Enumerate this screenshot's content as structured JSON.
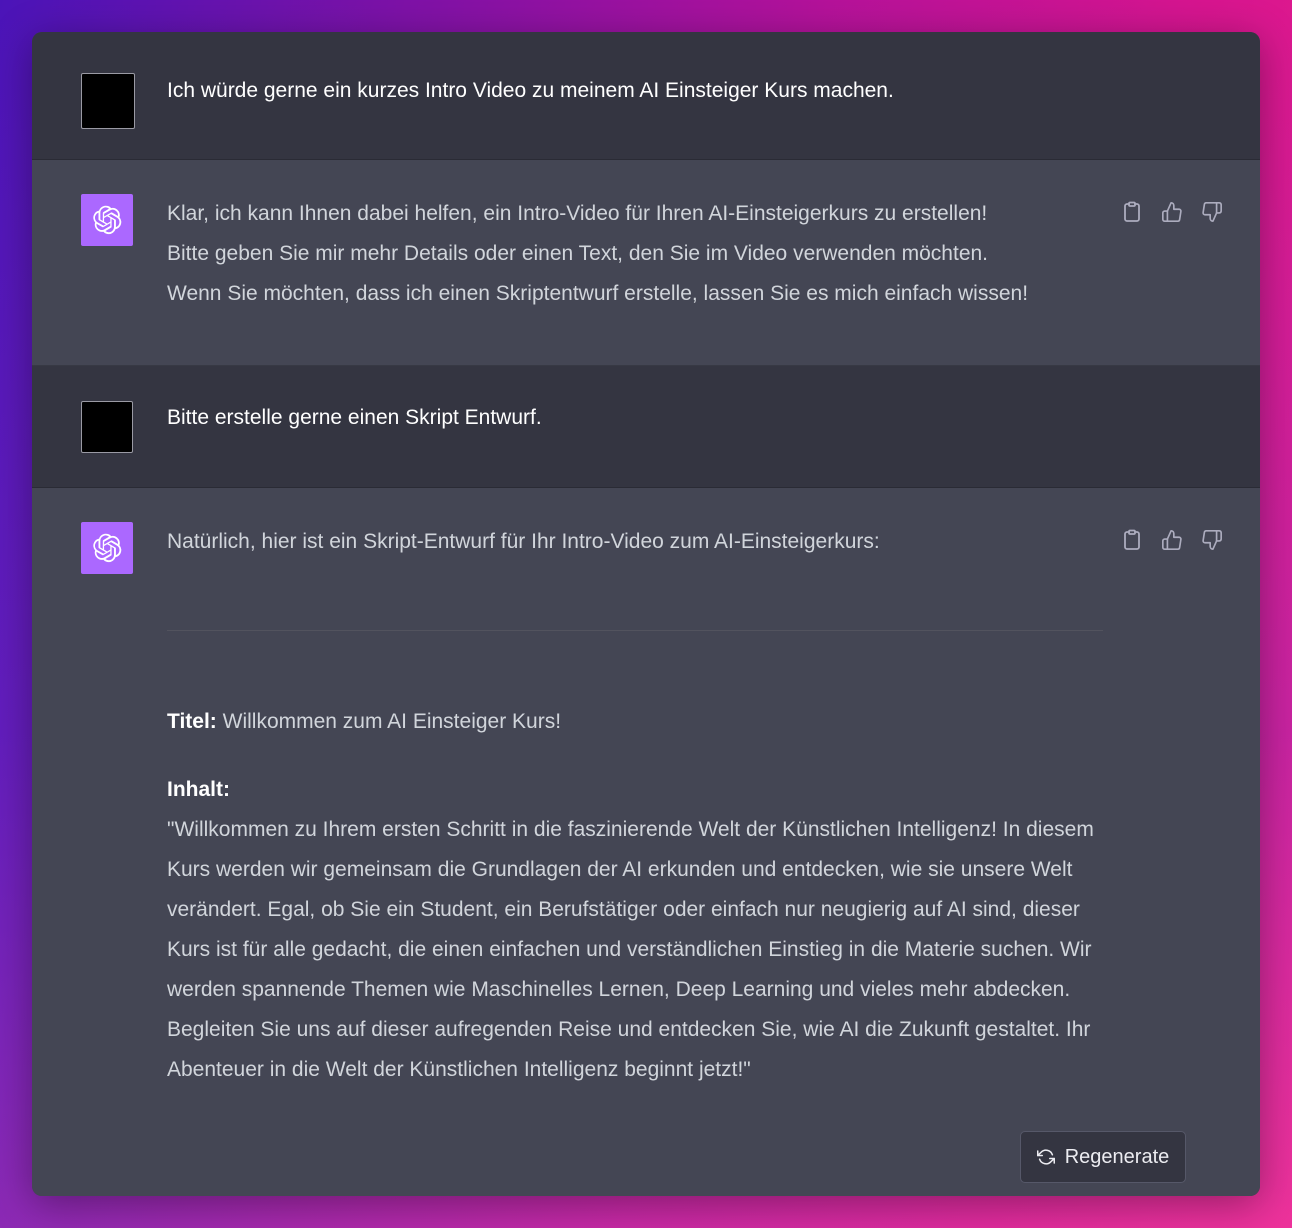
{
  "conversation": [
    {
      "role": "user",
      "text": "Ich würde gerne ein kurzes Intro Video zu meinem AI Einsteiger Kurs machen."
    },
    {
      "role": "assistant",
      "lines": [
        "Klar, ich kann Ihnen dabei helfen, ein Intro-Video für Ihren AI-Einsteigerkurs zu erstellen!",
        "Bitte geben Sie mir mehr Details oder einen Text, den Sie im Video verwenden möchten.",
        "Wenn Sie möchten, dass ich einen Skriptentwurf erstelle, lassen Sie es mich einfach wissen!"
      ]
    },
    {
      "role": "user",
      "text": "Bitte erstelle gerne einen Skript Entwurf."
    },
    {
      "role": "assistant",
      "intro": "Natürlich, hier ist ein Skript-Entwurf für Ihr Intro-Video zum AI-Einsteigerkurs:",
      "title_label": "Titel:",
      "title_value": " Willkommen zum AI Einsteiger Kurs!",
      "content_label": "Inhalt:",
      "content": "\"Willkommen zu Ihrem ersten Schritt in die faszinierende Welt der Künstlichen Intelligenz! In diesem Kurs werden wir gemeinsam die Grundlagen der AI erkunden und entdecken, wie sie unsere Welt verändert. Egal, ob Sie ein Student, ein Berufstätiger oder einfach nur neugierig auf AI sind, dieser Kurs ist für alle gedacht, die einen einfachen und verständlichen Einstieg in die Materie suchen. Wir werden spannende Themen wie Maschinelles Lernen, Deep Learning und vieles mehr abdecken. Begleiten Sie uns auf dieser aufregenden Reise und entdecken Sie, wie AI die Zukunft gestaltet. Ihr Abenteuer in die Welt der Künstlichen Intelligenz beginnt jetzt!\""
    }
  ],
  "regenerate_label": "Regenerate",
  "colors": {
    "user_bg": "#343541",
    "assistant_bg": "#444654",
    "gpt_avatar": "#ab68ff"
  },
  "icons": [
    "clipboard-icon",
    "thumbs-up-icon",
    "thumbs-down-icon",
    "openai-logo-icon",
    "refresh-icon"
  ]
}
